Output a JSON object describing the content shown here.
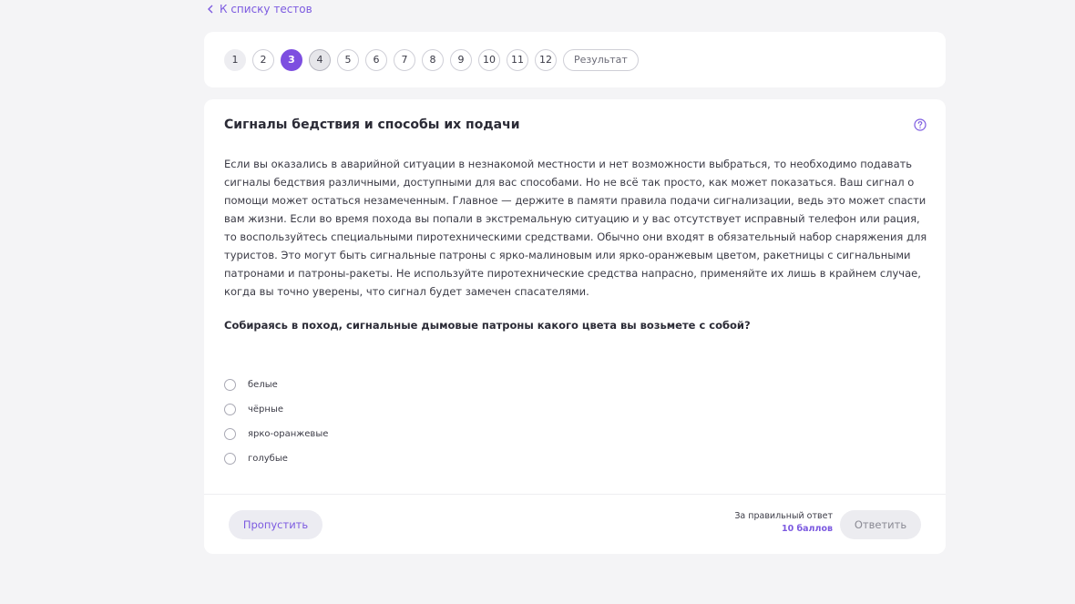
{
  "back_link": {
    "label": "К списку тестов"
  },
  "question_nav": {
    "items": [
      "1",
      "2",
      "3",
      "4",
      "5",
      "6",
      "7",
      "8",
      "9",
      "10",
      "11",
      "12"
    ],
    "current": "3",
    "result_label": "Результат"
  },
  "question": {
    "title": "Сигналы бедствия и способы их подачи",
    "text": "Если вы оказались в аварийной ситуации в незнакомой местности и нет возможности выбраться, то необходимо подавать сигналы бедствия различными, доступными для вас способами. Но не всё так просто, как может показаться. Ваш сигнал о помощи может остаться незамеченным. Главное — держите в памяти правила подачи сигнализации, ведь это может спасти вам жизни. Если во время похода вы попали в экстремальную ситуацию и у вас отсутствует исправный телефон или рация, то воспользуйтесь специальными пиротехническими средствами. Обычно они входят в обязательный набор снаряжения для туристов. Это могут быть сигнальные патроны с ярко-малиновым или ярко-оранжевым цветом, ракетницы с сигнальными патронами и патроны-ракеты. Не используйте пиротехнические средства напрасно, применяйте их лишь в крайнем случае, когда вы точно уверены, что сигнал будет замечен спасателями.",
    "prompt": "Собираясь в поход, сигнальные дымовые патроны какого цвета вы возьмете с собой?",
    "options": [
      "белые",
      "чёрные",
      "ярко-оранжевые",
      "голубые"
    ]
  },
  "footer": {
    "skip_label": "Пропустить",
    "score_label": "За правильный ответ",
    "score_value": "10 баллов",
    "answer_label": "Ответить"
  },
  "colors": {
    "accent": "#7d4ee0",
    "background": "#f4f4f6",
    "card": "#ffffff"
  }
}
